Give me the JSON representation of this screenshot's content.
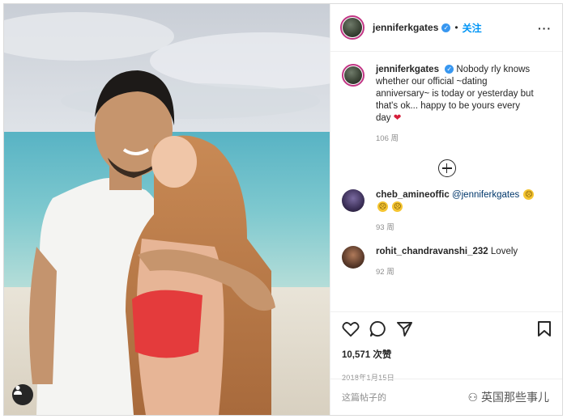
{
  "post": {
    "username": "jenniferkgates",
    "dot": "•",
    "follow_label": "关注",
    "more_label": "···",
    "caption_text": "Nobody rly knows whether our official ~dating anniversary~ is today or yesterday but that's ok... happy to be yours every day",
    "caption_heart": "❤",
    "caption_age": "106 周",
    "likes": "10,571 次赞",
    "date": "2018年1月15日",
    "comment_placeholder": "这篇帖子的",
    "verified_glyph": "✓"
  },
  "comments": [
    {
      "username": "cheb_amineoffic",
      "mention": "@jenniferkgates",
      "emoji": [
        "☹",
        "☹",
        "☹"
      ],
      "age": "93 周"
    },
    {
      "username": "rohit_chandravanshi_232",
      "text": "Lovely",
      "age": "92 周"
    }
  ],
  "watermark": "英国那些事儿",
  "icons": {
    "like": "heart-icon",
    "comment": "comment-icon",
    "share": "share-icon",
    "save": "bookmark-icon",
    "load_more": "plus-circle-icon",
    "user_tag": "user-tag-icon"
  },
  "colors": {
    "follow": "#0095f6",
    "verified": "#3897f0",
    "story_ring": "#c13584",
    "heart": "#d61f3b"
  }
}
